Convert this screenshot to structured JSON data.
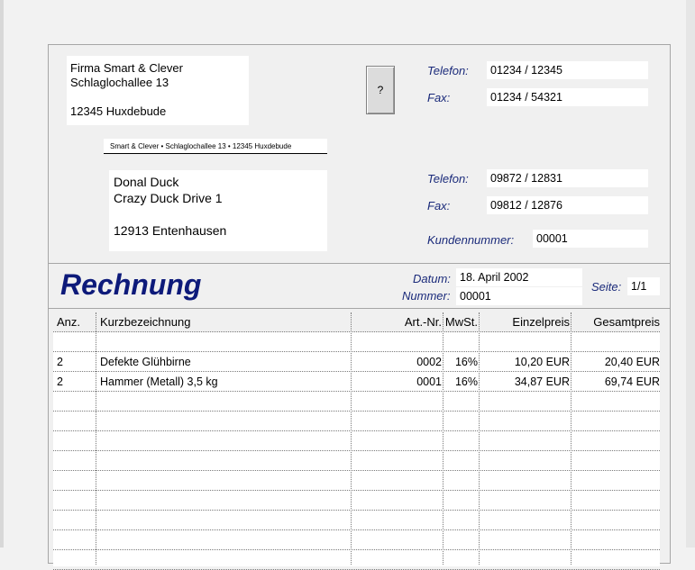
{
  "sender": {
    "line1": "Firma Smart & Clever",
    "line2": "Schlaglochallee 13",
    "line3": "12345 Huxdebude"
  },
  "help_button": "?",
  "sender_contact": {
    "phone_label": "Telefon:",
    "phone": "01234 / 12345",
    "fax_label": "Fax:",
    "fax": "01234 / 54321"
  },
  "return_address": "Smart & Clever  •  Schlaglochallee 13  •  12345 Huxdebude",
  "recipient": {
    "line1": "Donal Duck",
    "line2": "Crazy Duck Drive 1",
    "line3": "12913 Entenhausen"
  },
  "recipient_contact": {
    "phone_label": "Telefon:",
    "phone": "09872 / 12831",
    "fax_label": "Fax:",
    "fax": "09812 / 12876",
    "customer_label": "Kundennummer:",
    "customer": "00001"
  },
  "invoice": {
    "title": "Rechnung",
    "date_label": "Datum:",
    "date": "18. April 2002",
    "number_label": "Nummer:",
    "number": "00001",
    "page_label": "Seite:",
    "page": "1/1"
  },
  "table": {
    "headers": [
      "Anz.",
      "Kurzbezeichnung",
      "Art.-Nr.",
      "MwSt.",
      "Einzelpreis",
      "Gesamtpreis"
    ],
    "rows": [
      {
        "qty": "",
        "desc": "",
        "artnr": "",
        "vat": "",
        "unit": "",
        "total": ""
      },
      {
        "qty": "2",
        "desc": "Defekte Glühbirne",
        "artnr": "0002",
        "vat": "16%",
        "unit": "10,20 EUR",
        "total": "20,40 EUR"
      },
      {
        "qty": "2",
        "desc": "Hammer (Metall) 3,5 kg",
        "artnr": "0001",
        "vat": "16%",
        "unit": "34,87 EUR",
        "total": "69,74 EUR"
      }
    ]
  }
}
